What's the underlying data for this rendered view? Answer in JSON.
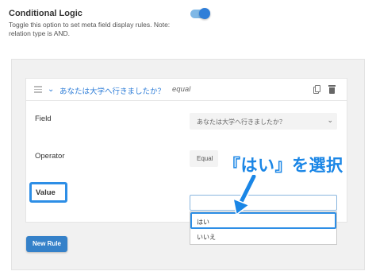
{
  "section": {
    "title": "Conditional Logic",
    "description": "Toggle this option to set meta field display rules. Note: relation type is AND.",
    "toggle_on": true
  },
  "rule": {
    "name": "あなたは大学へ行きましたか？",
    "operator": "equal",
    "field_label": "Field",
    "field_value": "あなたは大学へ行きましたか？",
    "operator_label": "Operator",
    "operator_value": "Equal",
    "value_label": "Value",
    "value_options": [
      "はい",
      "いいえ"
    ],
    "highlighted_option": "はい"
  },
  "annotation": {
    "text": "『はい』を選択"
  },
  "buttons": {
    "new_rule": "New Rule"
  },
  "colors": {
    "accent": "#2f7ed8",
    "annotation": "#1a86e6",
    "highlight_border": "#2d8ee6"
  }
}
